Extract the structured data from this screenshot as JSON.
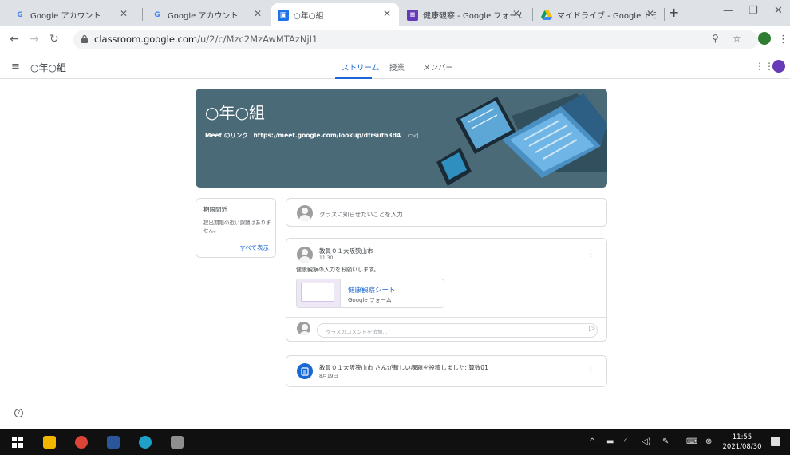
{
  "browser": {
    "tabs": [
      {
        "title": "Google アカウント",
        "icon": "google-g-icon",
        "active": false
      },
      {
        "title": "Google アカウント",
        "icon": "google-g-icon",
        "active": false
      },
      {
        "title": "○年○組",
        "icon": "classroom-icon",
        "active": true
      },
      {
        "title": "健康観察 - Google フォーム",
        "icon": "google-forms-icon",
        "active": false
      },
      {
        "title": "マイドライブ - Google ドライブ",
        "icon": "google-drive-icon",
        "active": false
      }
    ],
    "new_tab": "+",
    "url_host": "classroom.google.com",
    "url_path": "/u/2/c/Mzc2MzAwMTAzNjI1"
  },
  "header": {
    "class_title": "○年○組",
    "nav_tabs": [
      "ストリーム",
      "授業",
      "メンバー"
    ],
    "active_tab": "ストリーム"
  },
  "banner": {
    "title": "○年○組",
    "meet_label": "Meet のリンク",
    "meet_url": "https://meet.google.com/lookup/dfrsufh3d4",
    "color": "#4b6a78"
  },
  "upcoming": {
    "title": "期限間近",
    "body": "提出期限の近い課題はありません。",
    "link": "すべて表示"
  },
  "stream": {
    "announce_placeholder": "クラスに知らせたいことを入力",
    "post": {
      "author": "教員０１大阪狭山市",
      "time": "11:30",
      "body": "健康観察の入力をお願いします。",
      "attachment_title": "健康観察シート",
      "attachment_type": "Google フォーム",
      "comment_placeholder": "クラスのコメントを追加..."
    },
    "assignment": {
      "text": "教員０１大阪狭山市 さんが新しい課題を投稿しました: 算数01",
      "date": "8月19日"
    }
  },
  "taskbar": {
    "time": "11:55",
    "date": "2021/08/30"
  },
  "colors": {
    "accent": "#1967d2",
    "banner": "#4b6a78"
  }
}
